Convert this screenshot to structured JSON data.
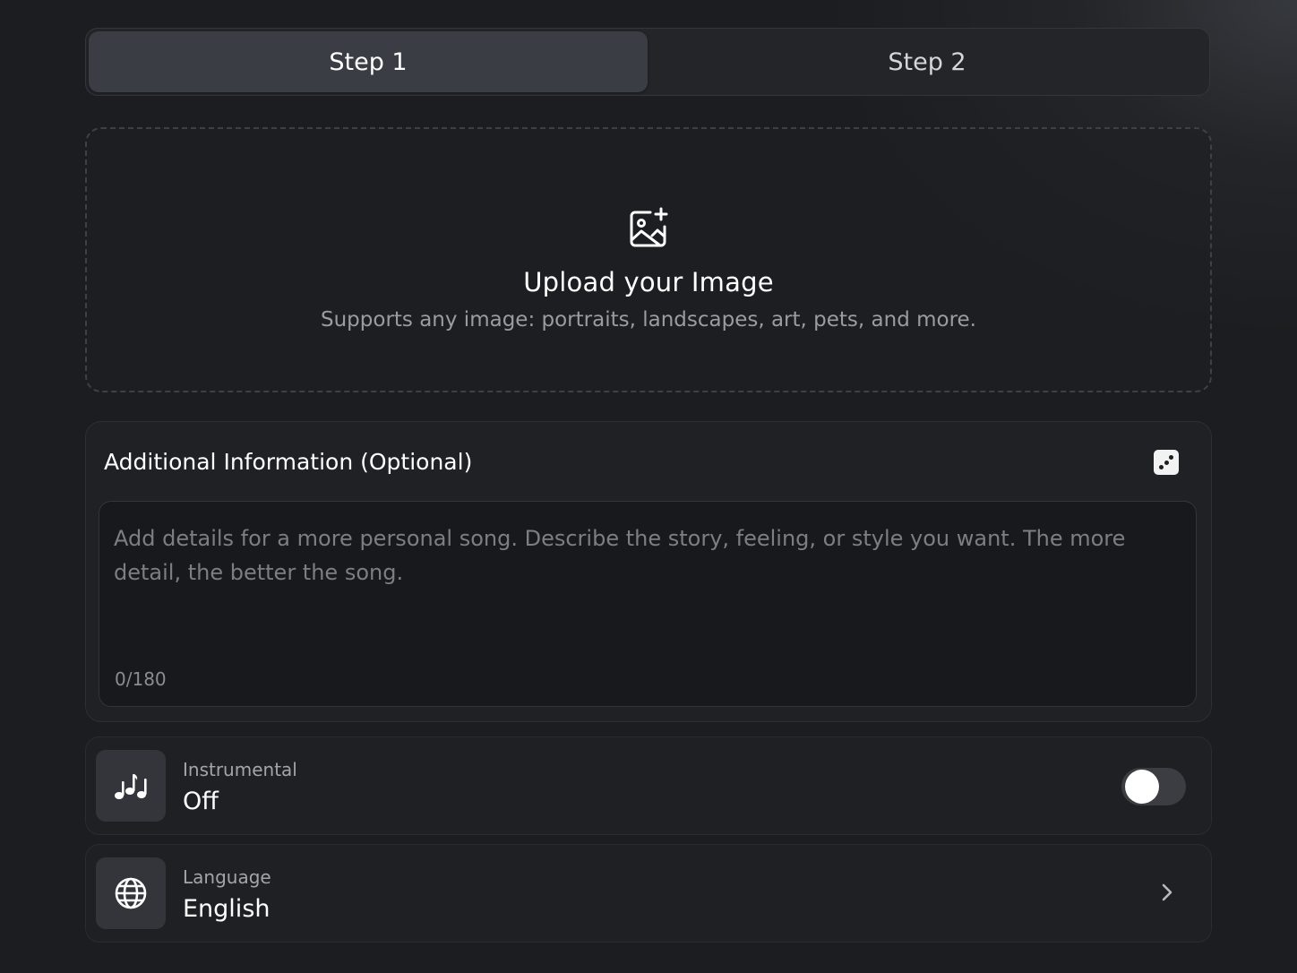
{
  "steps": {
    "items": [
      {
        "label": "Step 1",
        "active": true
      },
      {
        "label": "Step 2",
        "active": false
      }
    ]
  },
  "upload": {
    "icon": "image-plus-icon",
    "title": "Upload your Image",
    "subtitle": "Supports any image: portraits, landscapes, art, pets, and more."
  },
  "additional_info": {
    "title": "Additional Information (Optional)",
    "dice_icon": "dice-icon",
    "placeholder": "Add details for a more personal song. Describe the story, feeling, or style you want. The more detail, the better the song.",
    "value": "",
    "counter": "0/180"
  },
  "instrumental": {
    "icon": "music-notes-icon",
    "label": "Instrumental",
    "value": "Off",
    "enabled": false
  },
  "language": {
    "icon": "globe-icon",
    "label": "Language",
    "value": "English",
    "chevron_icon": "chevron-right-icon"
  },
  "colors": {
    "background": "#1c1d20",
    "card": "#202125",
    "active_tab": "#3a3d44",
    "text_primary": "#ffffff",
    "text_secondary": "#9a9ca2"
  }
}
